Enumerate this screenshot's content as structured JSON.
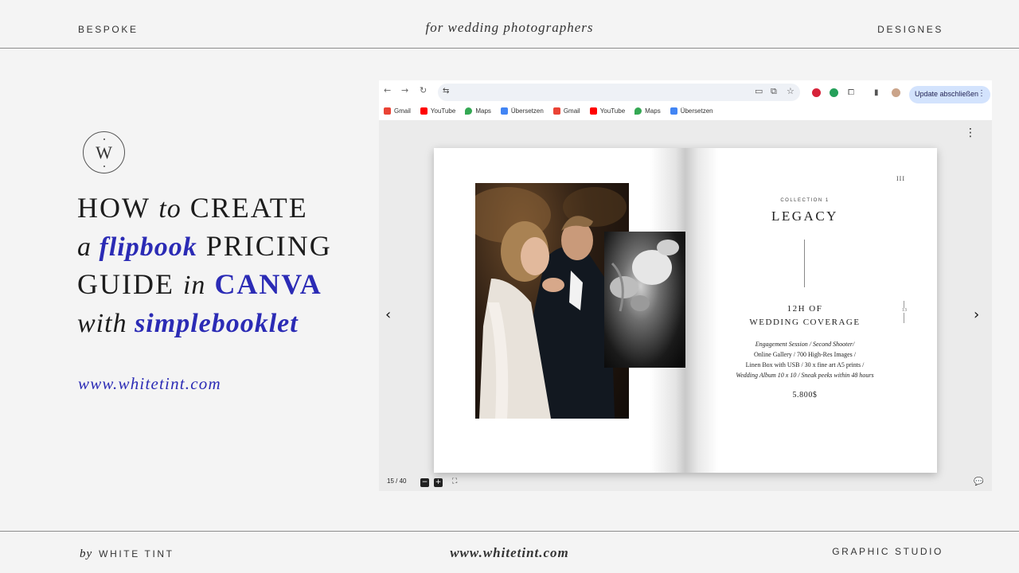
{
  "header": {
    "left": "BESPOKE",
    "center": "for wedding photographers",
    "right": "DESIGNES"
  },
  "footer": {
    "by": "by",
    "brand": "WHITE TINT",
    "center": "www.whitetint.com",
    "right": "GRAPHIC STUDIO"
  },
  "logo": {
    "letter": "W"
  },
  "headline": {
    "l1a": "HOW ",
    "l1b": "to",
    "l1c": " CREATE",
    "l2a": "a ",
    "l2b": "flipbook",
    "l2c": " PRICING",
    "l3a": "GUIDE ",
    "l3b": "in",
    "l3c": " CANVA",
    "l4a": "with ",
    "l4b": "simplebooklet"
  },
  "website": "www.whitetint.com",
  "browser": {
    "nav": {
      "back": "←",
      "forward": "→",
      "reload": "↻",
      "tune": "⇆"
    },
    "update_label": "Update abschließen",
    "bookmarks": [
      {
        "label": "Gmail",
        "color": "#ea4335"
      },
      {
        "label": "YouTube",
        "color": "#ff0000"
      },
      {
        "label": "Maps",
        "color": "#34a853"
      },
      {
        "label": "Übersetzen",
        "color": "#4285f4"
      },
      {
        "label": "Gmail",
        "color": "#ea4335"
      },
      {
        "label": "YouTube",
        "color": "#ff0000"
      },
      {
        "label": "Maps",
        "color": "#34a853"
      },
      {
        "label": "Übersetzen",
        "color": "#4285f4"
      }
    ]
  },
  "viewer": {
    "page_counter": "15 / 40",
    "zoom_out": "−",
    "zoom_in": "+",
    "prev": "‹",
    "next": "›"
  },
  "booklet": {
    "page_number": "III",
    "collection_label": "COLLECTION 1",
    "title": "LEGACY",
    "side_mark": "13",
    "coverage_line1": "12H OF",
    "coverage_line2": "WEDDING COVERAGE",
    "desc1": "Engagement Session / Second Shooter/",
    "desc2": "Online Gallery / 700 High-Res Images /",
    "desc3": "Linen Box with USB / 30 x fine art A5 prints /",
    "desc4": "Wedding Album 10 x 10 / Sneak peeks within 48 hours",
    "price": "5.800$"
  },
  "colors": {
    "accent": "#2b2bb5",
    "background": "#f4f4f4"
  }
}
